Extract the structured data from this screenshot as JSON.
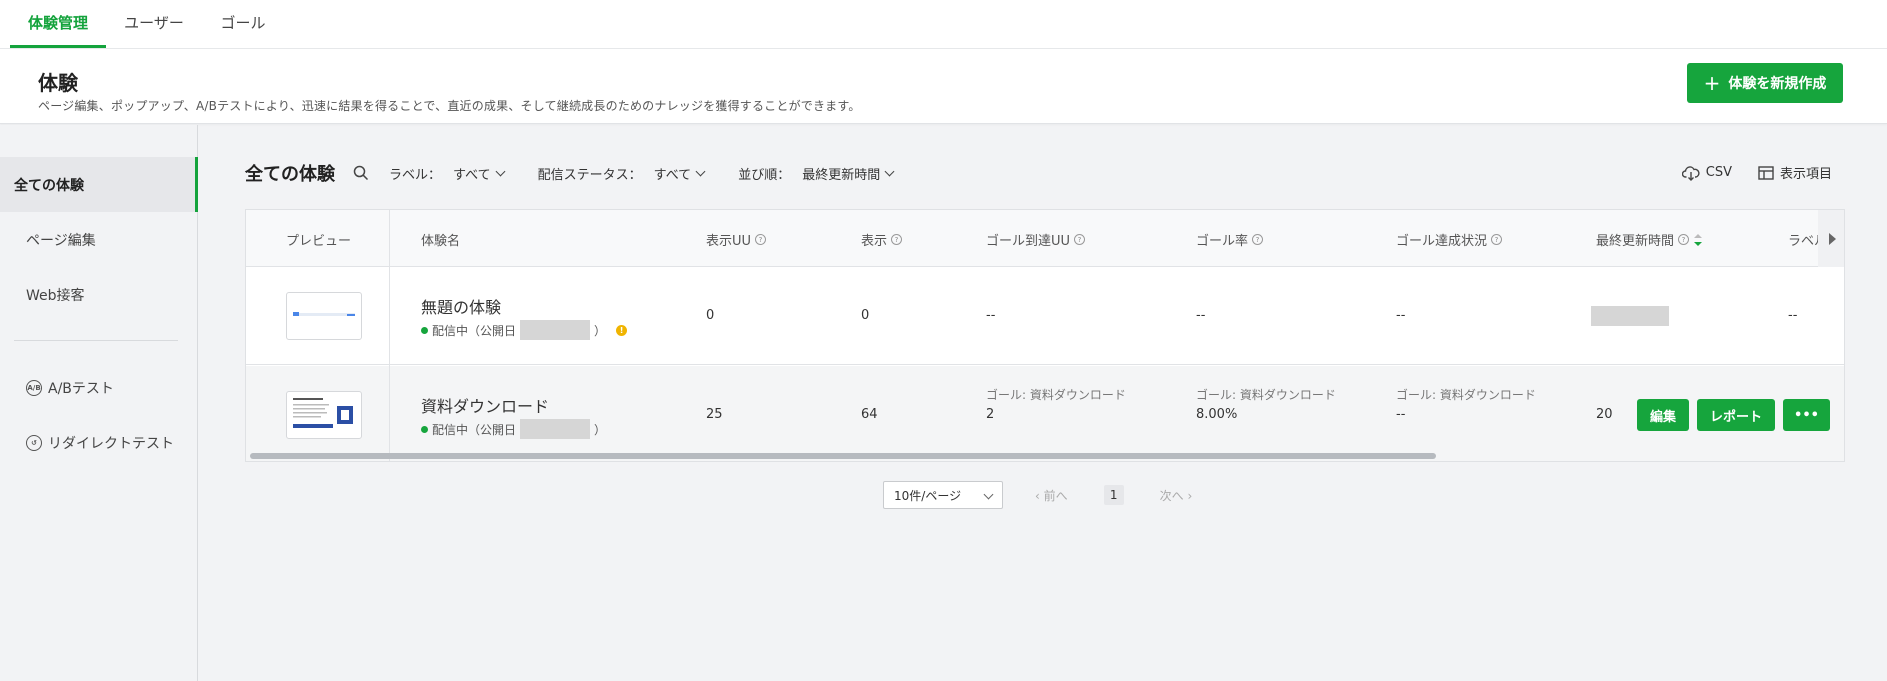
{
  "top_tabs": [
    {
      "label": "体験管理",
      "active": true
    },
    {
      "label": "ユーザー",
      "active": false
    },
    {
      "label": "ゴール",
      "active": false
    }
  ],
  "header": {
    "title": "体験",
    "description": "ページ編集、ポップアップ、A/Bテストにより、迅速に結果を得ることで、直近の成果、そして継続成長のためのナレッジを獲得することができます。",
    "create_button": "体験を新規作成"
  },
  "sidebar": {
    "items": [
      {
        "label": "全ての体験",
        "active": true
      },
      {
        "label": "ページ編集"
      },
      {
        "label": "Web接客"
      },
      {
        "label": "A/Bテスト",
        "icon": "ab-test-icon"
      },
      {
        "label": "リダイレクトテスト",
        "icon": "redirect-icon"
      }
    ]
  },
  "filters": {
    "title": "全ての体験",
    "label_label": "ラベル：",
    "label_value": "すべて",
    "status_label": "配信ステータス：",
    "status_value": "すべて",
    "sort_label": "並び順：",
    "sort_value": "最終更新時間"
  },
  "tools": {
    "csv": "CSV",
    "columns": "表示項目"
  },
  "table": {
    "headers": [
      "プレビュー",
      "体験名",
      "表示UU",
      "表示",
      "ゴール到達UU",
      "ゴール率",
      "ゴール達成状況",
      "最終更新時間",
      "ラベル"
    ],
    "rows": [
      {
        "name": "無題の体験",
        "status": "配信中（公開日",
        "status_end": "）",
        "display_uu": "0",
        "display": "0",
        "goal_uu": "--",
        "goal_rate": "--",
        "goal_status": "--",
        "label": "--"
      },
      {
        "name": "資料ダウンロード",
        "status": "配信中（公開日",
        "status_end": "）",
        "display_uu": "25",
        "display": "64",
        "goal_label": "ゴール: 資料ダウンロード",
        "goal_uu": "2",
        "goal_rate": "8.00%",
        "goal_status": "--",
        "updated_partial": "20",
        "actions": {
          "edit": "編集",
          "report": "レポート",
          "more": "•••"
        }
      }
    ]
  },
  "pagination": {
    "per_page": "10件/ページ",
    "prev": "前へ",
    "page": "1",
    "next": "次へ"
  },
  "colors": {
    "accent": "#16a53d",
    "warning": "#f0b400"
  }
}
